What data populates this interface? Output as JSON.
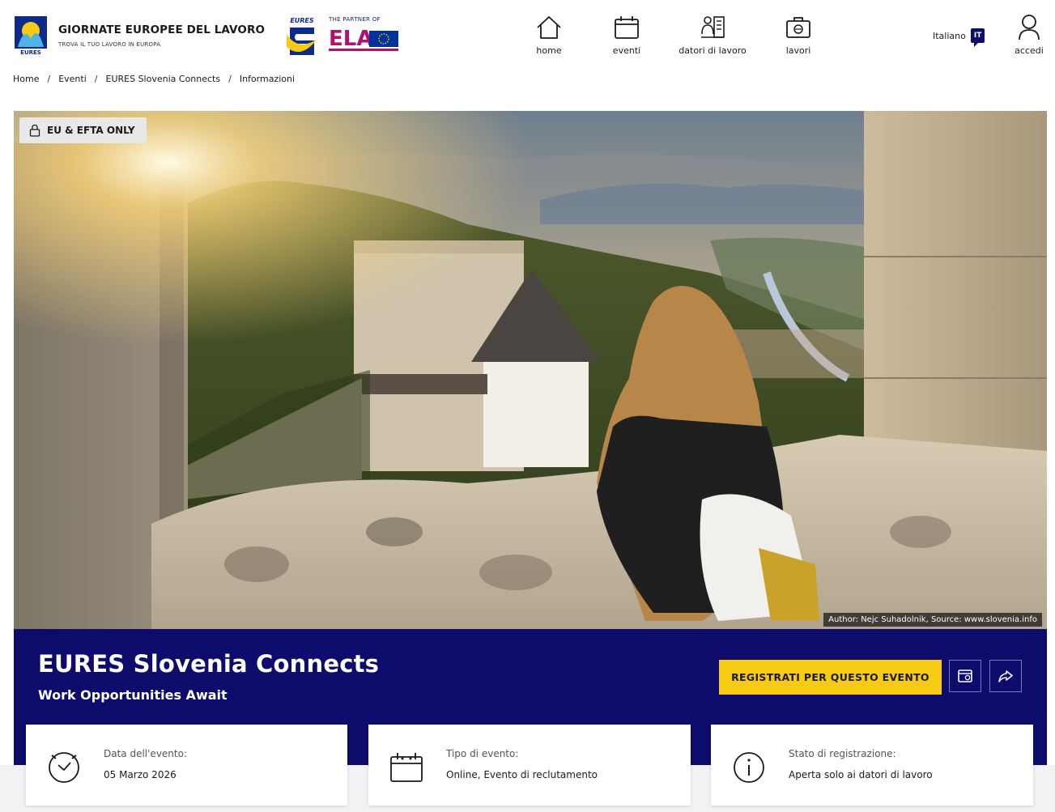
{
  "header": {
    "brand_title": "GIORNATE EUROPEE DEL LAVORO",
    "brand_subtitle": "TROVA IL TUO LAVORO IN EUROPA",
    "eures_text": "EURES",
    "partner_text": "THE PARTNER OF",
    "ela_text": "ELA",
    "nav": [
      {
        "label": "home",
        "icon": "home-icon"
      },
      {
        "label": "eventi",
        "icon": "calendar-icon"
      },
      {
        "label": "datori di lavoro",
        "icon": "employers-icon"
      },
      {
        "label": "lavori",
        "icon": "briefcase-icon"
      }
    ],
    "language_label": "Italiano",
    "language_code": "IT",
    "login_label": "accedi"
  },
  "breadcrumb": [
    "Home",
    "Eventi",
    "EURES Slovenia Connects",
    "Informazioni"
  ],
  "hero": {
    "badge": "EU & EFTA ONLY",
    "credit": "Author: Nejc Suhadolnik, Source: www.slovenia.info"
  },
  "event": {
    "title": "EURES Slovenia Connects",
    "subtitle": "Work Opportunities Await",
    "register_label": "REGISTRATI PER QUESTO EVENTO"
  },
  "cards": [
    {
      "label": "Data dell'evento:",
      "value": "05 Marzo 2026",
      "icon": "clock-icon"
    },
    {
      "label": "Tipo di evento:",
      "value": "Online, Evento di reclutamento",
      "icon": "calendar-icon"
    },
    {
      "label": "Stato di registrazione:",
      "value": "Aperta solo ai datori di lavoro",
      "icon": "info-icon"
    }
  ],
  "colors": {
    "banner": "#0d0c6c",
    "accent": "#f7cb14",
    "lang_badge": "#0e0c6e"
  }
}
